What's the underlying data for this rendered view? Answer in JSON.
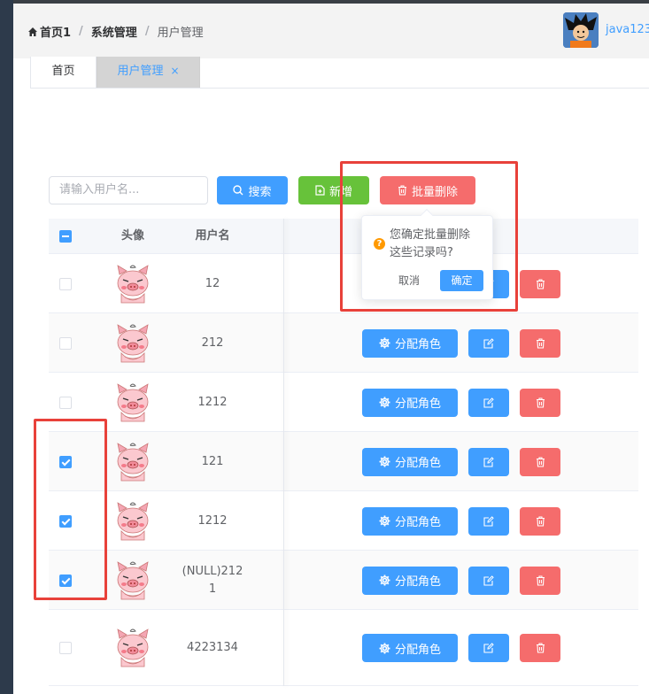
{
  "breadcrumb": {
    "items": [
      "首页1",
      "系统管理",
      "用户管理"
    ],
    "separator": "/"
  },
  "header": {
    "username": "java123"
  },
  "tabs": [
    {
      "label": "首页",
      "active": false
    },
    {
      "label": "用户管理",
      "active": true,
      "close": "×"
    }
  ],
  "toolbar": {
    "search_placeholder": "请输入用户名...",
    "search_label": "搜索",
    "add_label": "新增",
    "batch_delete_label": "批量删除"
  },
  "table": {
    "columns": [
      "头像",
      "用户名"
    ],
    "assign_role_label": "分配角色",
    "rows": [
      {
        "username": "12",
        "checked": false
      },
      {
        "username": "212",
        "checked": false
      },
      {
        "username": "1212",
        "checked": false
      },
      {
        "username": "121",
        "checked": true
      },
      {
        "username": "1212",
        "checked": true
      },
      {
        "username": "(NULL)2121",
        "username_line1": "(NULL)212",
        "username_line2": "1",
        "checked": true
      },
      {
        "username": "4223134",
        "checked": false
      }
    ]
  },
  "popconfirm": {
    "message": "您确定批量删除这些记录吗?",
    "message_line1": "您确定批量删除",
    "message_line2": "这些记录吗?",
    "cancel_label": "取消",
    "confirm_label": "确定"
  },
  "colors": {
    "primary": "#409eff",
    "success": "#67c23a",
    "danger": "#f56c6c",
    "warning": "#ff9900",
    "highlight": "#e8413a"
  }
}
